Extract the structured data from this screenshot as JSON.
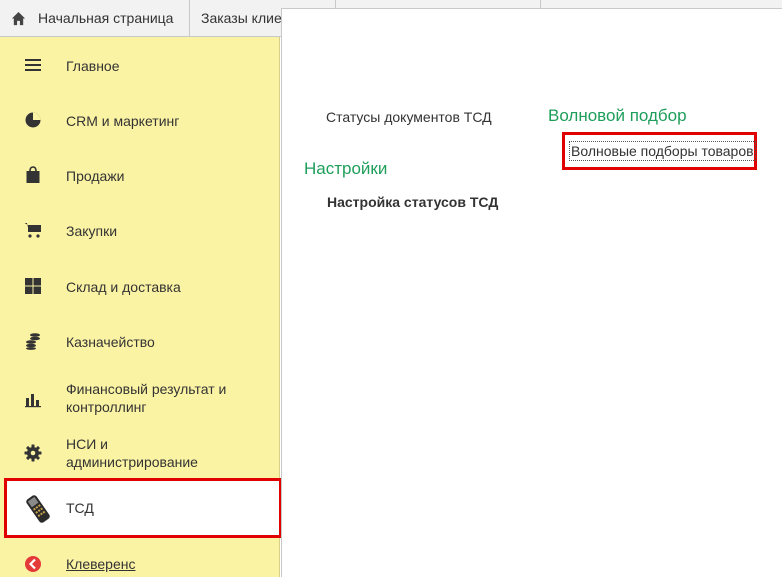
{
  "tabs": {
    "home": "Начальная страница",
    "orders": "Заказы клие"
  },
  "sidebar": {
    "items": [
      {
        "label": "Главное",
        "icon": "menu-icon"
      },
      {
        "label": "CRM и маркетинг",
        "icon": "pie-chart-icon"
      },
      {
        "label": "Продажи",
        "icon": "shopping-bag-icon"
      },
      {
        "label": "Закупки",
        "icon": "cart-icon"
      },
      {
        "label": "Склад и доставка",
        "icon": "grid-icon"
      },
      {
        "label": "Казначейство",
        "icon": "coins-icon"
      },
      {
        "label": "Финансовый результат и",
        "label2": "контроллинг",
        "icon": "bar-chart-icon"
      },
      {
        "label": "НСИ и",
        "label2": "администрирование",
        "icon": "gear-icon"
      },
      {
        "label": "ТСД",
        "icon": "barcode-scanner-icon",
        "selected": true
      },
      {
        "label": "Клеверенс",
        "icon": "cleverence-icon"
      }
    ]
  },
  "content": {
    "statuses_link": "Статусы документов ТСД",
    "settings_heading": "Настройки",
    "settings_status_link": "Настройка статусов ТСД",
    "wave_heading": "Волновой подбор",
    "wave_link": "Волновые подборы товаров"
  },
  "colors": {
    "sidebar_bg": "#fbf3a4",
    "heading_green": "#1e9e5a",
    "highlight_red": "#e10000"
  }
}
